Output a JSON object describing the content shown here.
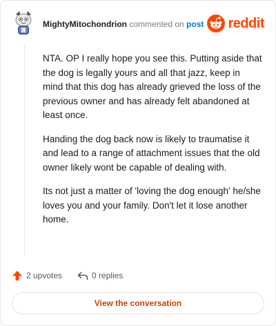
{
  "comment": {
    "username": "MightyMitochondrion",
    "commented_text": "commented on",
    "post_link": "post",
    "paragraphs": [
      "NTA. OP I really hope you see this. Putting aside that the dog is legally yours and all that jazz, keep in mind that this dog has already grieved the loss of the previous owner and has already felt abandoned at least once.",
      "Handing the dog back now is likely to traumatise it and lead to a range of attachment issues that the old owner likely wont be capable of dealing with.",
      "Its not just a matter of 'loving the dog enough' he/she loves you and your family. Don't let it lose another home."
    ]
  },
  "brand": {
    "wordmark": "reddit",
    "color": "#ff4500",
    "icon": "reddit-alien-icon"
  },
  "actions": {
    "upvotes_label": "2 upvotes",
    "replies_label": "0 replies",
    "upvote_icon": "upvote-arrow-icon",
    "reply_icon": "reply-arrow-icon",
    "upvote_color": "#ff4500"
  },
  "footer": {
    "view_conversation_label": "View the conversation",
    "label_color": "#cc3d00"
  },
  "avatar": {
    "icon": "snoo-avatar-icon"
  }
}
